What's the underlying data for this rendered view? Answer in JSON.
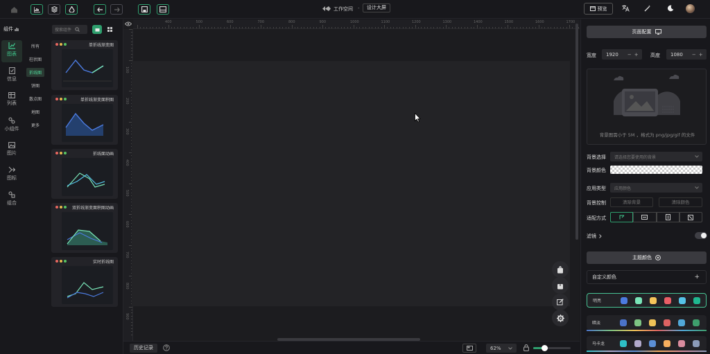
{
  "topbar": {
    "workspace": "工作空间",
    "separator": "-",
    "project_name": "设计大屏",
    "preview_label": "预览"
  },
  "left_panel": {
    "title": "组件",
    "search_placeholder": "搜索组件",
    "categories": [
      {
        "label": "图表",
        "icon": "chart-icon"
      },
      {
        "label": "信息",
        "icon": "info-icon"
      },
      {
        "label": "列表",
        "icon": "table-icon"
      },
      {
        "label": "小组件",
        "icon": "widget-icon"
      },
      {
        "label": "图片",
        "icon": "image-icon"
      },
      {
        "label": "图标",
        "icon": "icon-icon"
      },
      {
        "label": "组合",
        "icon": "group-icon"
      }
    ],
    "subcategories": [
      "所有",
      "柱状图",
      "折线图",
      "饼图",
      "散点图",
      "地图",
      "更多"
    ],
    "active_subcategory": "折线图",
    "cards": [
      {
        "title": "单折线渐变图"
      },
      {
        "title": "单折线渐变面积图"
      },
      {
        "title": "折线面动画"
      },
      {
        "title": "双折线渐变面积图动画"
      },
      {
        "title": "实时折线图"
      }
    ]
  },
  "ruler_labels": [
    "400",
    "500",
    "600",
    "700",
    "800",
    "900",
    "1000",
    "1100",
    "1200",
    "1300",
    "1400",
    "1500",
    "1600",
    "1700",
    "1800"
  ],
  "vruler_labels": [
    "100",
    "200",
    "300",
    "400",
    "500",
    "600",
    "700",
    "800",
    "900",
    "1000"
  ],
  "bottombar": {
    "history_label": "历史记录",
    "zoom": "62%"
  },
  "right_panel": {
    "page_config_label": "页面配置",
    "width_label": "宽度",
    "width_value": "1920",
    "height_label": "高度",
    "height_value": "1080",
    "upload_hint": "背景图需小于 5M ，格式为 png/jpg/gif 的文件",
    "bg_select_label": "背景选择",
    "bg_select_placeholder": "请选择您要使用的背景",
    "bg_color_label": "背景颜色",
    "apply_type_label": "应用类型",
    "apply_type_value": "应用颜色",
    "bg_control_label": "背景控制",
    "clear_bg_label": "清除背景",
    "clear_color_label": "清除颜色",
    "fit_label": "适配方式",
    "filter_label": "滤镜",
    "theme_color_label": "主题颜色",
    "custom_color_label": "自定义颜色",
    "themes": [
      {
        "name": "明亮",
        "colors": [
          "#4c7be0",
          "#79e5b8",
          "#f6c55a",
          "#e95e66",
          "#55c3e8",
          "#1fb890"
        ]
      },
      {
        "name": "暗淡",
        "colors": [
          "#4b73c9",
          "#7dc483",
          "#f0c257",
          "#de6262",
          "#51a8d8",
          "#3e9e6c"
        ]
      },
      {
        "name": "马卡龙",
        "colors": [
          "#2ebfc6",
          "#b1a9cb",
          "#5b8fd6",
          "#f6ae5e",
          "#d98c9e",
          "#8b9bb8"
        ]
      }
    ]
  },
  "colors": {
    "accent": "#2f9f6e",
    "theme_active_border": "#48c394"
  }
}
